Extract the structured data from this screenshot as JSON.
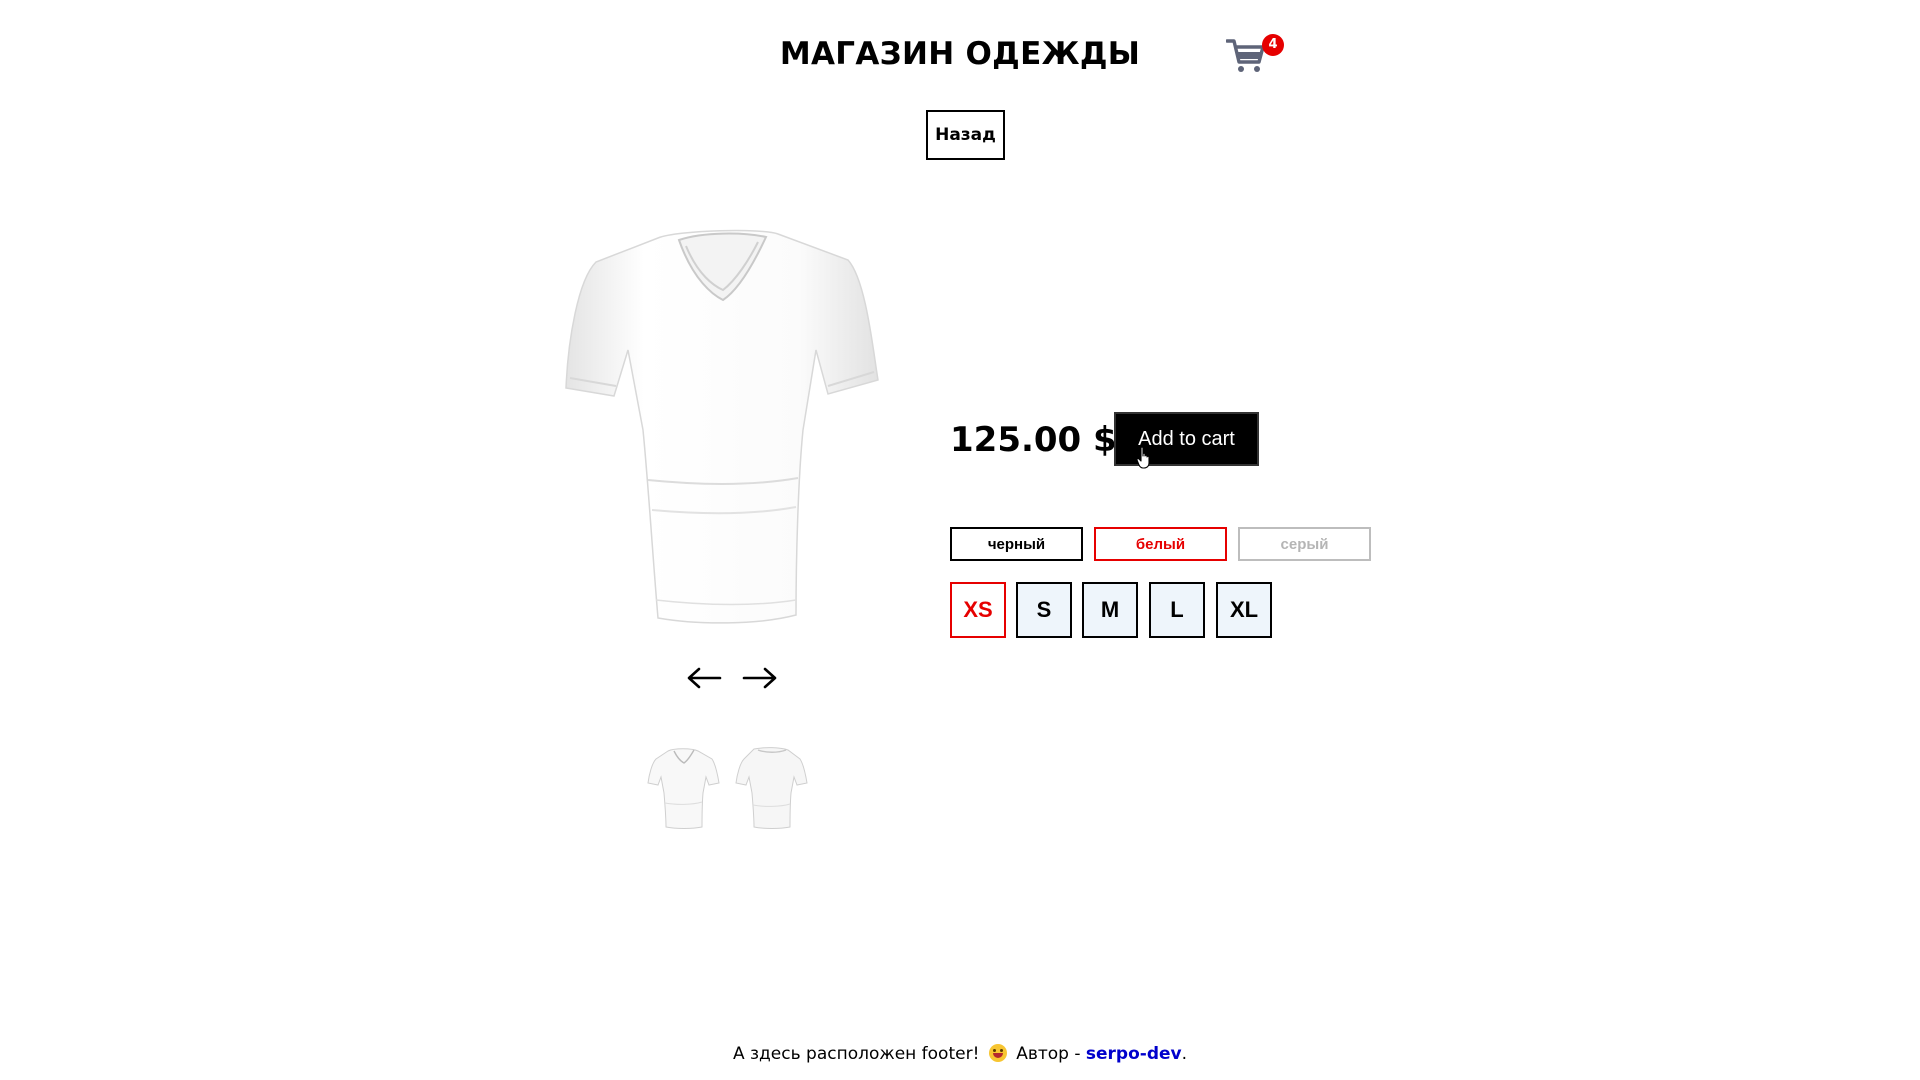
{
  "header": {
    "title": "МАГАЗИН ОДЕЖДЫ",
    "cart_icon": "shopping-cart-icon",
    "cart_count": "4"
  },
  "navigation": {
    "back_label": "Назад"
  },
  "product": {
    "price": "125.00 $",
    "add_to_cart_label": "Add to cart",
    "image_icon": "white-tshirt-front",
    "prev_icon": "arrow-left-icon",
    "next_icon": "arrow-right-icon",
    "thumbnails": [
      "white-tshirt-front",
      "white-tshirt-back"
    ],
    "colors": [
      {
        "label": "черный",
        "state": "default"
      },
      {
        "label": "белый",
        "state": "selected"
      },
      {
        "label": "серый",
        "state": "disabled"
      }
    ],
    "sizes": [
      {
        "label": "XS",
        "state": "selected"
      },
      {
        "label": "S",
        "state": "default"
      },
      {
        "label": "M",
        "state": "default"
      },
      {
        "label": "L",
        "state": "default"
      },
      {
        "label": "XL",
        "state": "default"
      }
    ]
  },
  "footer": {
    "text_before": "А здесь расположен footer!",
    "text_author": "Автор -",
    "author_link": "serpo-dev",
    "text_after": "."
  },
  "colors": {
    "accent_red": "#e60000",
    "link_blue": "#0000cc",
    "size_bg": "#eef5fb"
  }
}
